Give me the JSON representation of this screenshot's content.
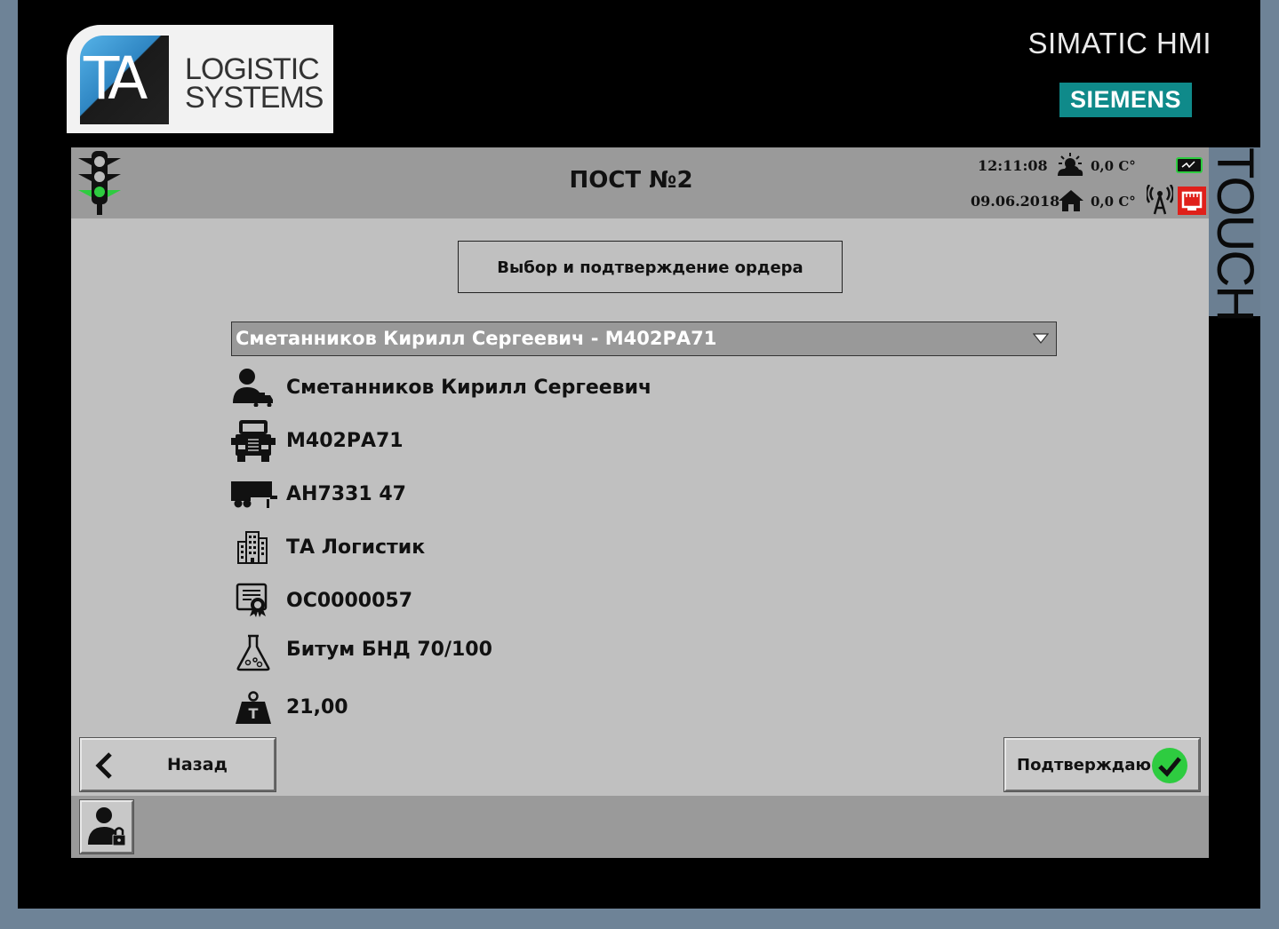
{
  "brand": {
    "logo_mark": "TA",
    "logo_line1": "LOGISTIC",
    "logo_line2": "SYSTEMS",
    "simatic": "SIMATIC HMI",
    "siemens": "SIEMENS",
    "touch": "TOUCH"
  },
  "header": {
    "title": "ПОСТ №2",
    "time": "12:11:08",
    "date": "09.06.2018",
    "outdoor_temp": "0,0 C°",
    "indoor_temp": "0,0 C°",
    "traffic_light_state": "green"
  },
  "main": {
    "section_title": "Выбор и подтверждение ордера",
    "order_select": {
      "selected": "Сметанников Кирилл Сергеевич - М402РА71"
    },
    "rows": [
      {
        "icon": "driver-truck-icon",
        "value": "Сметанников Кирилл Сергеевич"
      },
      {
        "icon": "truck-icon",
        "value": "М402РА71"
      },
      {
        "icon": "trailer-icon",
        "value": "АН7331 47"
      },
      {
        "icon": "building-icon",
        "value": "ТА Логистик"
      },
      {
        "icon": "certificate-icon",
        "value": "ОС0000057"
      },
      {
        "icon": "flask-icon",
        "value": "Битум БНД 70/100"
      },
      {
        "icon": "weight-icon",
        "value": "21,00"
      }
    ]
  },
  "buttons": {
    "back": "Назад",
    "confirm": "Подтверждаю"
  },
  "colors": {
    "accent_green": "#2ecc40",
    "status_red": "#e0201a",
    "siemens_teal": "#0f8a8a"
  }
}
